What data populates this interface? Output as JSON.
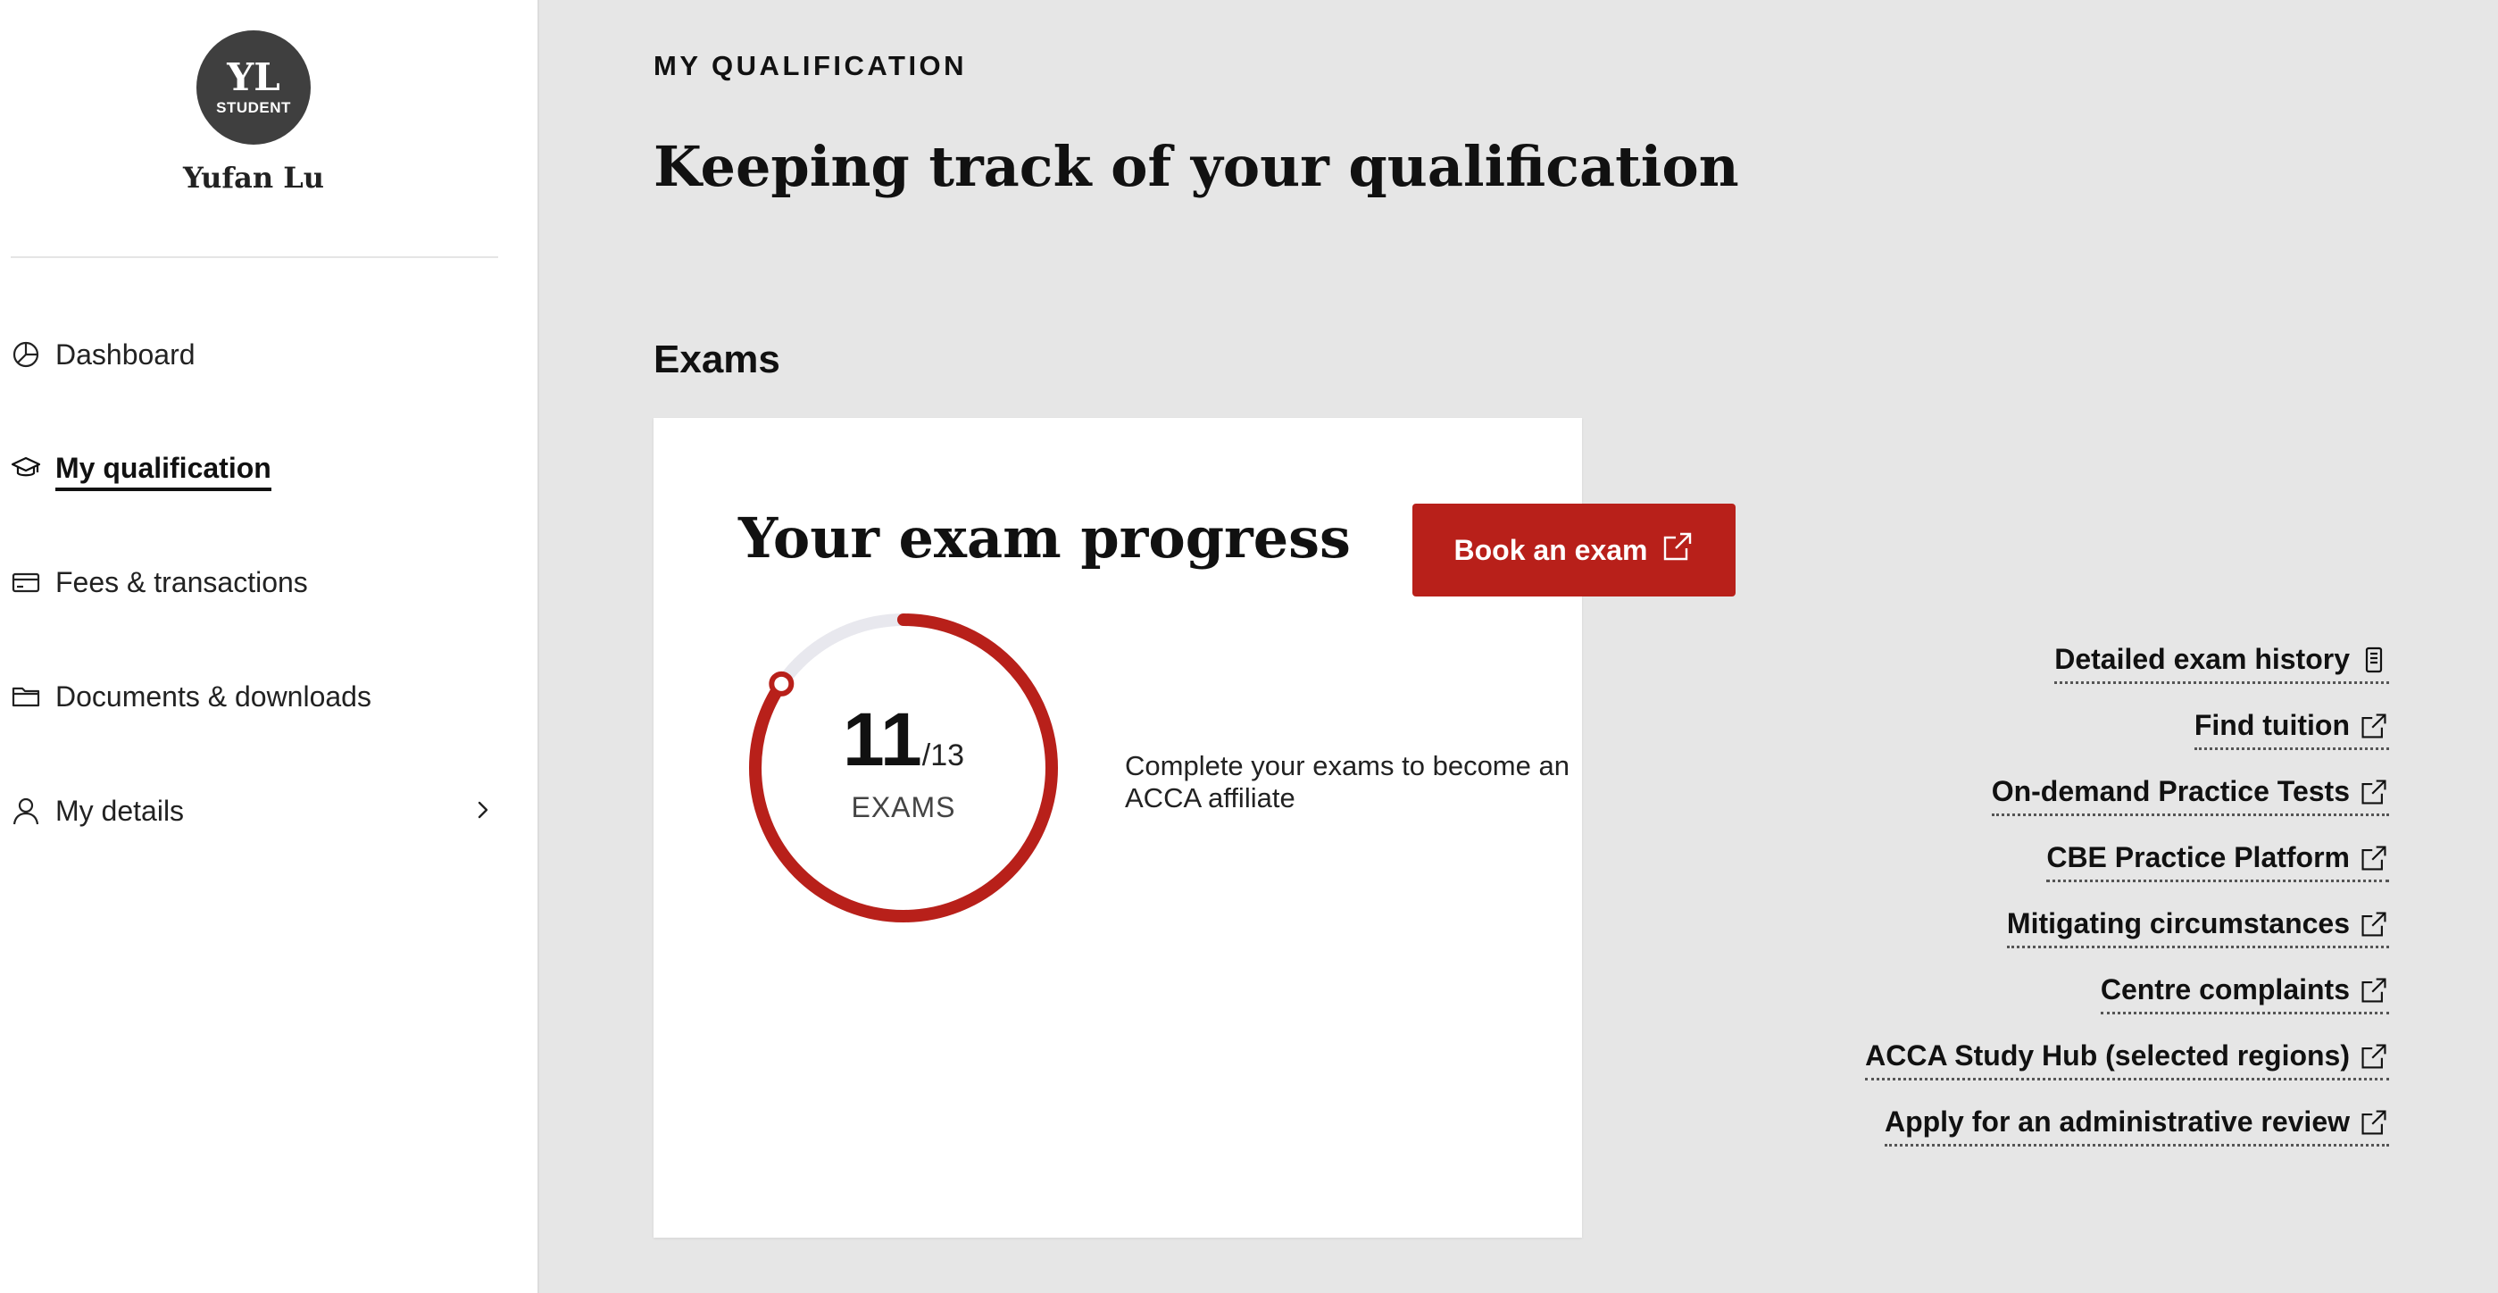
{
  "user": {
    "initials": "YL",
    "role": "STUDENT",
    "name": "Yufan Lu"
  },
  "sidebar": {
    "items": [
      {
        "label": "Dashboard",
        "icon": "pie-chart-icon",
        "active": false
      },
      {
        "label": "My qualification",
        "icon": "graduation-cap-icon",
        "active": true
      },
      {
        "label": "Fees & transactions",
        "icon": "credit-card-icon",
        "active": false
      },
      {
        "label": "Documents & downloads",
        "icon": "folder-icon",
        "active": false
      },
      {
        "label": "My details",
        "icon": "person-icon",
        "active": false,
        "has_chevron": true
      }
    ]
  },
  "header": {
    "eyebrow": "MY QUALIFICATION",
    "title": "Keeping track of your qualification"
  },
  "exams": {
    "section_title": "Exams",
    "card_title": "Your exam progress",
    "completed": "11",
    "total": "/13",
    "count_label": "EXAMS",
    "progress_fraction": 0.846,
    "description": "Complete your exams to become an ACCA affiliate",
    "book_button": "Book an exam",
    "links": [
      {
        "label": "Detailed exam history",
        "icon": "document-icon"
      },
      {
        "label": "Find tuition",
        "icon": "external-link-icon"
      },
      {
        "label": "On-demand Practice Tests",
        "icon": "external-link-icon"
      },
      {
        "label": "CBE Practice Platform",
        "icon": "external-link-icon"
      },
      {
        "label": "Mitigating circumstances",
        "icon": "external-link-icon"
      },
      {
        "label": "Centre complaints",
        "icon": "external-link-icon"
      },
      {
        "label": "ACCA Study Hub (selected regions)",
        "icon": "external-link-icon"
      },
      {
        "label": "Apply for an administrative review",
        "icon": "external-link-icon"
      }
    ]
  },
  "colors": {
    "accent": "#b8201a",
    "ring_track": "#e8e8ee",
    "page_bg": "#e6e6e6",
    "avatar_bg": "#3f3f3f"
  }
}
